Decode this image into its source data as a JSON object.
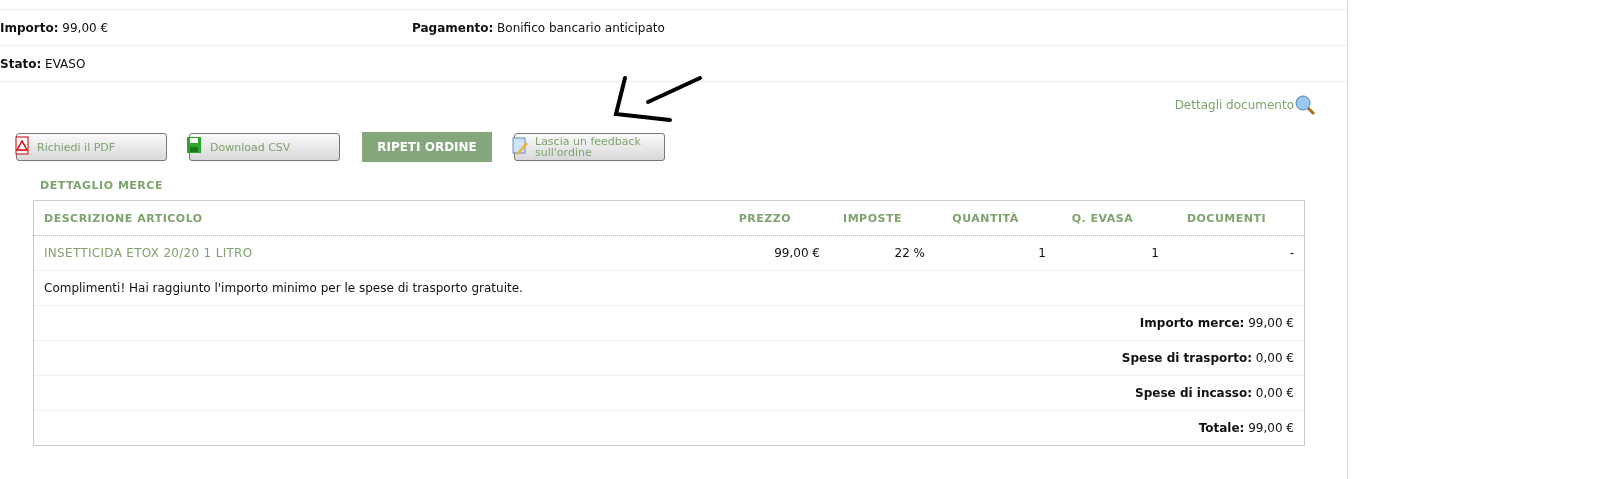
{
  "info_rows": [
    [
      {
        "label": "Importo:",
        "value": "99,00 €"
      },
      {
        "label": "Pagamento:",
        "value": "Bonifico bancario anticipato"
      }
    ],
    [
      {
        "label": "Stato:",
        "value": "EVASO"
      }
    ]
  ],
  "details_link": "Dettagli documento",
  "actions": [
    {
      "kind": "pdf",
      "label": "Richiedi il PDF"
    },
    {
      "kind": "csv",
      "label": "Download CSV"
    },
    {
      "kind": "primary",
      "label": "RIPETI ORDINE"
    },
    {
      "kind": "feedback",
      "label": "Lascia un feedback sull'ordine"
    }
  ],
  "section_title": "DETTAGLIO MERCE",
  "table": {
    "columns": [
      "DESCRIZIONE ARTICOLO",
      "PREZZO",
      "IMPOSTE",
      "QUANTITÀ",
      "Q. EVASA",
      "DOCUMENTI"
    ],
    "rows": [
      [
        "INSETTICIDA ETOX 20/20 1 LITRO",
        "99,00 €",
        "22 %",
        "1",
        "1",
        "-"
      ]
    ],
    "note": "Complimenti! Hai raggiunto l'importo minimo per le spese di trasporto gratuite.",
    "totals": [
      {
        "label": "Importo merce:",
        "value": "99,00 €"
      },
      {
        "label": "Spese di trasporto:",
        "value": "0,00 €"
      },
      {
        "label": "Spese di incasso:",
        "value": "0,00 €"
      },
      {
        "label": "Totale:",
        "value": "99,00 €"
      }
    ]
  }
}
